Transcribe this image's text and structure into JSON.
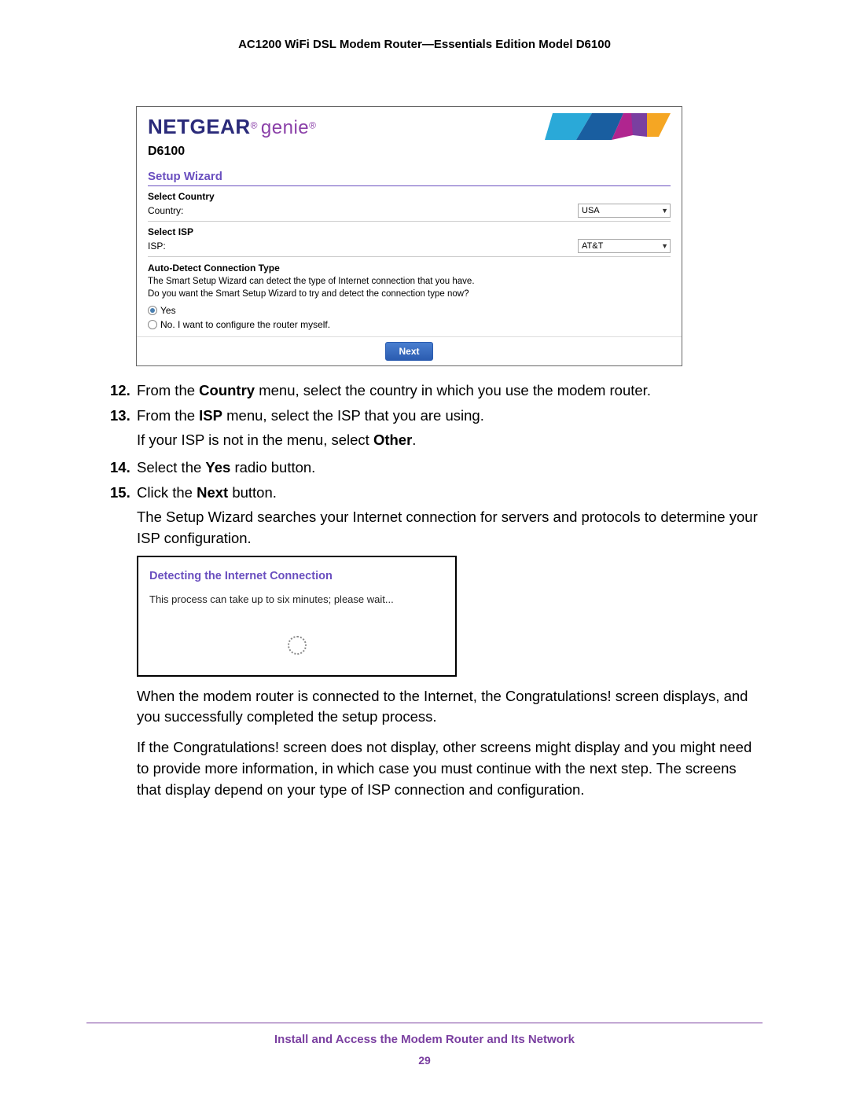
{
  "doc_title": "AC1200 WiFi DSL Modem Router—Essentials Edition Model D6100",
  "wizard": {
    "brand_netgear": "NETGEAR",
    "brand_genie": "genie",
    "model": "D6100",
    "section_title": "Setup Wizard",
    "select_country_label": "Select Country",
    "country_label": "Country:",
    "country_value": "USA",
    "select_isp_label": "Select ISP",
    "isp_label": "ISP:",
    "isp_value": "AT&T",
    "autodetect_heading": "Auto-Detect Connection Type",
    "autodetect_line1": "The Smart Setup Wizard can detect the type of Internet connection that you have.",
    "autodetect_line2": "Do you want the Smart Setup Wizard to try and detect the connection type now?",
    "radio_yes": "Yes",
    "radio_no": "No. I want to configure the router myself.",
    "next_button": "Next"
  },
  "steps": {
    "s12_num": "12.",
    "s12_a": "From the ",
    "s12_b": "Country",
    "s12_c": " menu, select the country in which you use the modem router.",
    "s13_num": "13.",
    "s13_a": "From the ",
    "s13_b": "ISP",
    "s13_c": " menu, select the ISP that you are using.",
    "s13_sub_a": "If your ISP is not in the menu, select ",
    "s13_sub_b": "Other",
    "s13_sub_c": ".",
    "s14_num": "14.",
    "s14_a": "Select the ",
    "s14_b": "Yes",
    "s14_c": " radio button.",
    "s15_num": "15.",
    "s15_a": "Click the ",
    "s15_b": "Next",
    "s15_c": " button.",
    "s15_sub1": "The Setup Wizard searches your Internet connection for servers and protocols to determine your ISP configuration.",
    "detecting_title": "Detecting the Internet Connection",
    "detecting_text": "This process can take up to six minutes; please wait...",
    "s15_sub2": "When the modem router is connected to the Internet, the Congratulations! screen displays, and you successfully completed the setup process.",
    "s15_sub3": "If the Congratulations! screen does not display, other screens might display and you might need to provide more information, in which case you must continue with the next step. The screens that display depend on your type of ISP connection and configuration."
  },
  "footer": {
    "title": "Install and Access the Modem Router and Its Network",
    "page": "29"
  }
}
